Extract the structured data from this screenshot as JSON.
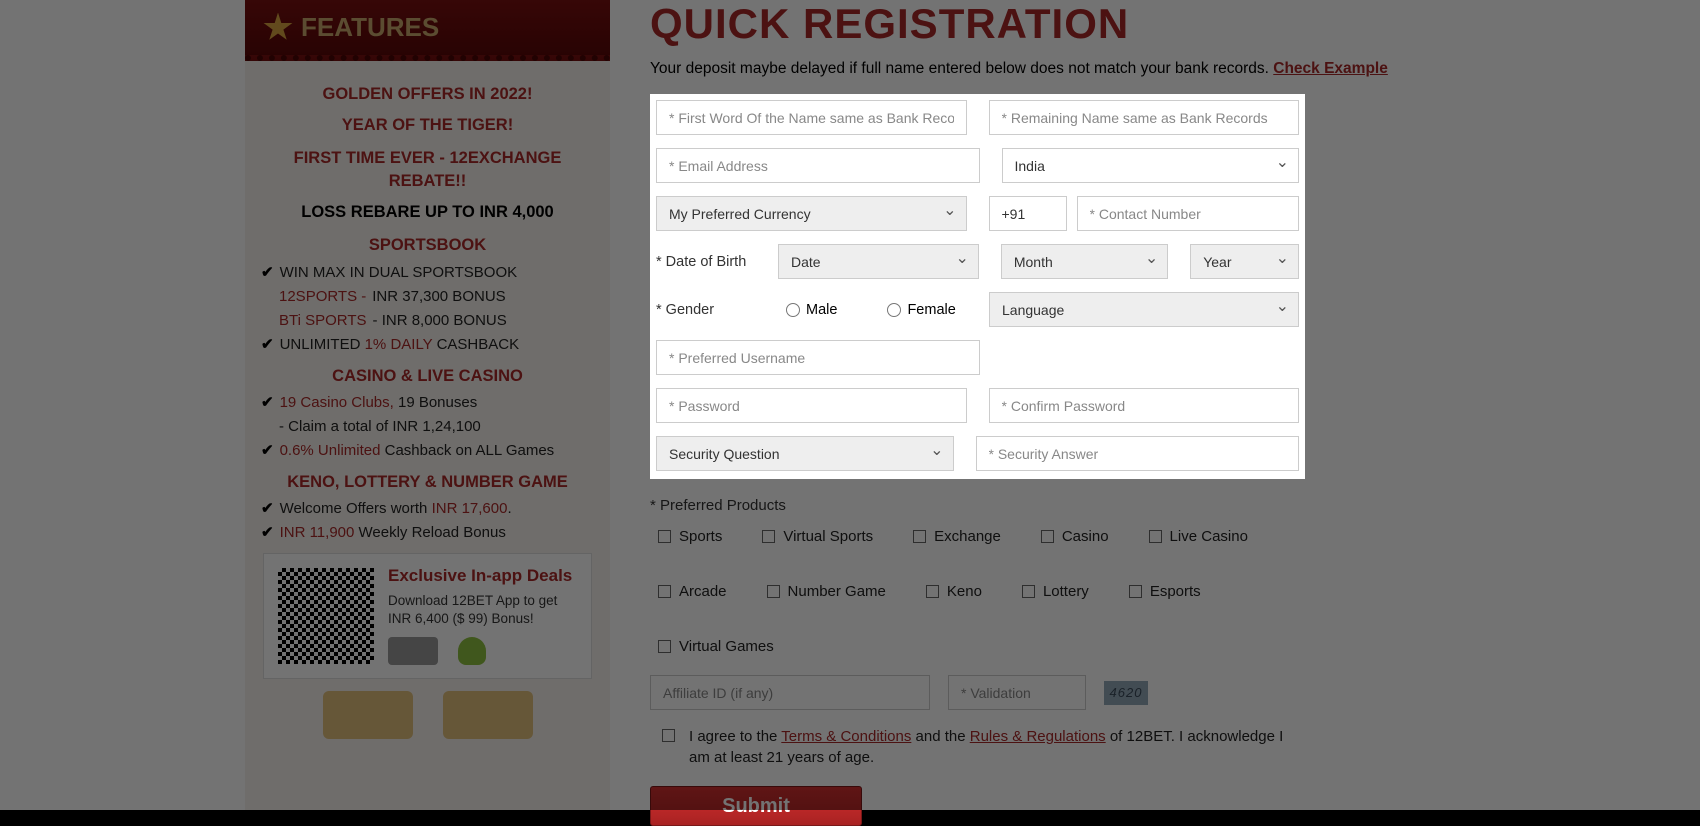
{
  "sidebar": {
    "header": "FEATURES",
    "golden1": "GOLDEN OFFERS IN 2022!",
    "golden2": "YEAR OF THE TIGER!",
    "rebate1": "FIRST TIME EVER - 12EXCHANGE REBATE!!",
    "rebate2": "LOSS REBARE UP TO INR 4,000",
    "sportsbook_h": "SPORTSBOOK",
    "sb_l1a": "WIN MAX IN DUAL SPORTSBOOK",
    "sb_l2a": "12SPORTS - ",
    "sb_l2b": "INR 37,300 BONUS",
    "sb_l3a": "BTi SPORTS",
    "sb_l3b": " - INR 8,000 BONUS",
    "sb_l4a": "UNLIMITED ",
    "sb_l4b": "1% DAILY",
    "sb_l4c": " CASHBACK",
    "casino_h": "CASINO & LIVE CASINO",
    "cs_l1a": "19 Casino Clubs,",
    "cs_l1b": " 19 Bonuses",
    "cs_l2": "- Claim a total of INR 1,24,100",
    "cs_l3a": "0.6% Unlimited",
    "cs_l3b": " Cashback on ALL Games",
    "keno_h": "KENO, LOTTERY & NUMBER GAME",
    "kn_l1a": "Welcome Offers worth ",
    "kn_l1b": "INR 17,600",
    "kn_l1c": ".",
    "kn_l2a": "INR 11,900",
    "kn_l2b": " Weekly Reload Bonus",
    "app_h": "Exclusive In-app Deals",
    "app_p": "Download 12BET App to get INR 6,400 ($ 99) Bonus!"
  },
  "main": {
    "title": "QUICK REGISTRATION",
    "deposit_note": "Your deposit maybe delayed if full name entered below does not match your bank records. ",
    "check_example": "Check Example",
    "ph_firstname": "* First Word Of the Name same as Bank Records",
    "ph_lastname": "* Remaining Name same as Bank Records",
    "ph_email": "* Email Address",
    "country": "India",
    "currency": "My Preferred Currency",
    "phone_code": "+91",
    "ph_contact": "* Contact Number",
    "dob_label": "* Date of Birth",
    "dob_date": "Date",
    "dob_month": "Month",
    "dob_year": "Year",
    "gender_label": "* Gender",
    "gender_male": "Male",
    "gender_female": "Female",
    "language": "Language",
    "ph_username": "* Preferred Username",
    "ph_password": "* Password",
    "ph_confirm": "* Confirm Password",
    "sec_question": "Security Question",
    "ph_sec_answer": "* Security Answer",
    "pref_products": "* Preferred Products",
    "products": [
      "Sports",
      "Virtual Sports",
      "Exchange",
      "Casino",
      "Live Casino",
      "Arcade",
      "Number Game",
      "Keno",
      "Lottery",
      "Esports",
      "Virtual Games"
    ],
    "ph_affiliate": "Affiliate ID (if any)",
    "ph_validation": "* Validation",
    "captcha": "4620",
    "terms_a": "I agree to the ",
    "terms_link1": "Terms & Conditions",
    "terms_b": " and the ",
    "terms_link2": "Rules & Regulations",
    "terms_c": " of 12BET. I acknowledge I am at least 21 years of age.",
    "submit": "Submit"
  }
}
